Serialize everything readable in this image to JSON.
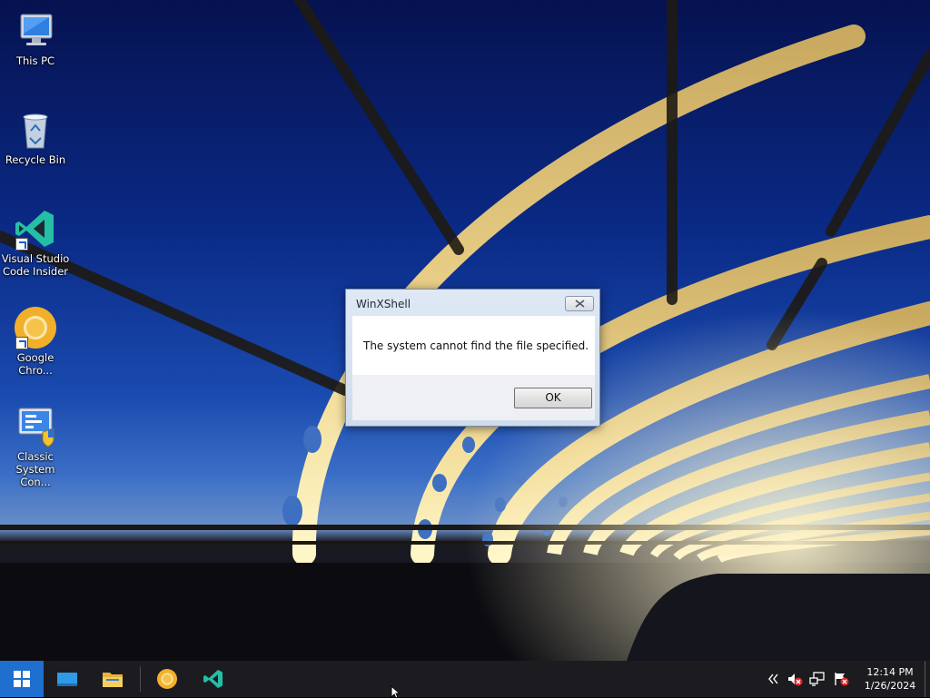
{
  "desktop": {
    "icons": [
      {
        "label": "This PC",
        "icon": "this-pc-icon"
      },
      {
        "label": "Recycle Bin",
        "icon": "recycle-bin-icon"
      },
      {
        "label": "Visual Studio Code Insider",
        "icon": "vscode-insiders-icon"
      },
      {
        "label": "Google Chro...",
        "icon": "chrome-canary-icon"
      },
      {
        "label": "Classic System Con...",
        "icon": "control-panel-icon"
      }
    ]
  },
  "dialog": {
    "title": "WinXShell",
    "message": "The system cannot find the file specified.",
    "ok_label": "OK"
  },
  "taskbar": {
    "pinned": [
      {
        "name": "desktop",
        "icon": "desktop-icon"
      },
      {
        "name": "file-explorer",
        "icon": "folder-icon"
      },
      {
        "name": "chrome",
        "icon": "chrome-canary-icon"
      },
      {
        "name": "vscode",
        "icon": "vscode-insiders-icon"
      }
    ],
    "tray": [
      "chevron-left-icon",
      "volume-muted-icon",
      "network-icon",
      "action-center-flag-icon"
    ],
    "clock": {
      "time": "12:14 PM",
      "date": "1/26/2024"
    }
  },
  "colors": {
    "start_button": "#1e6fd0",
    "taskbar": "#1c1c20",
    "vscode": "#24bfa5",
    "chrome_canary": "#f2b02a"
  }
}
